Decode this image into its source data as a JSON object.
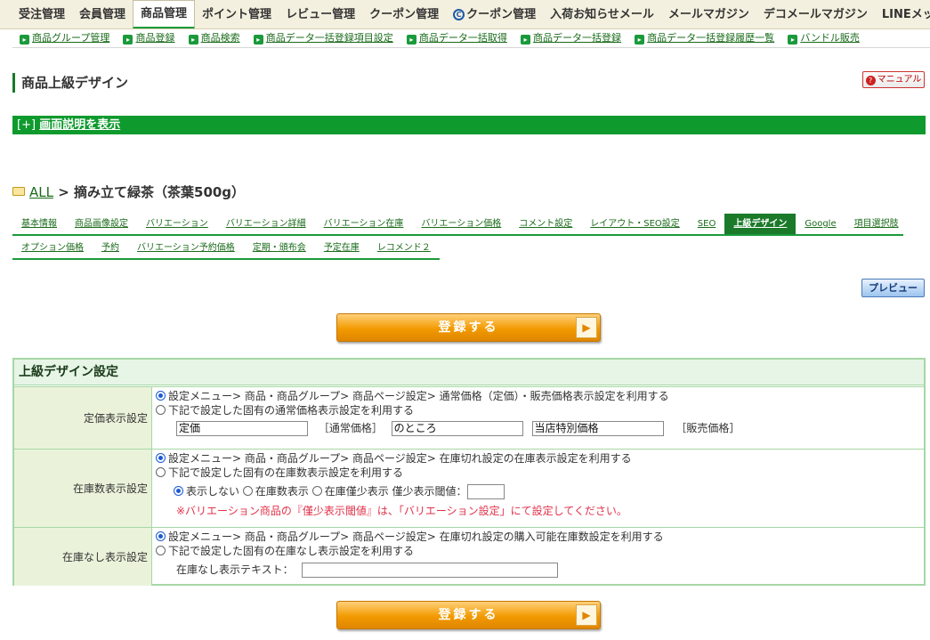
{
  "topnav": [
    "受注管理",
    "会員管理",
    "商品管理",
    "ポイント管理",
    "レビュー管理",
    "クーポン管理",
    "クーポン管理",
    "入荷お知らせメール",
    "メールマガジン",
    "デコメールマガジン",
    "LINEメッセー"
  ],
  "topnav_active_index": 2,
  "subnav": [
    "商品グループ管理",
    "商品登録",
    "商品検索",
    "商品データ一括登録項目設定",
    "商品データ一括取得",
    "商品データ一括登録",
    "商品データ一括登録履歴一覧",
    "バンドル販売"
  ],
  "page_title": "商品上級デザイン",
  "manual_label": "マニュアル",
  "help_toggle": "[+]",
  "help_link": "画面説明を表示",
  "breadcrumb": {
    "all": "ALL",
    "sep": " > ",
    "product": "摘み立て緑茶（茶葉500g）"
  },
  "tabs_row1": [
    "基本情報",
    "商品画像設定",
    "バリエーション",
    "バリエーション詳細",
    "バリエーション在庫",
    "バリエーション価格",
    "コメント設定",
    "レイアウト・SEO設定",
    "SEO",
    "上級デザイン",
    "Google",
    "項目選択肢"
  ],
  "tabs_row2": [
    "オプション価格",
    "予約",
    "バリエーション予約価格",
    "定期・頒布会",
    "予定在庫",
    "レコメンド２"
  ],
  "active_tab": "上級デザイン",
  "preview_label": "プレビュー",
  "save_label": "登録する",
  "settings": {
    "title": "上級デザイン設定",
    "price": {
      "label": "定価表示設定",
      "opt1": "設定メニュー> 商品・商品グループ> 商品ページ設定> 通常価格（定価）・販売価格表示設定を利用する",
      "opt2": "下記で設定した固有の通常価格表示設定を利用する",
      "field1": "定価",
      "tag1": "［通常価格］",
      "field2": "のところ",
      "field3": "当店特別価格",
      "tag2": "［販売価格］"
    },
    "stock": {
      "label": "在庫数表示設定",
      "opt1": "設定メニュー> 商品・商品グループ> 商品ページ設定> 在庫切れ設定の在庫表示設定を利用する",
      "opt2": "下記で設定した固有の在庫数表示設定を利用する",
      "sub_hide": "表示しない",
      "sub_show": "在庫数表示",
      "sub_few": "在庫僅少表示",
      "threshold_label": "僅少表示閾値：",
      "threshold_value": "",
      "note": "※バリエーション商品の『僅少表示閾値』は、「バリエーション設定」にて設定してください。"
    },
    "nostock": {
      "label": "在庫なし表示設定",
      "opt1": "設定メニュー> 商品・商品グループ> 商品ページ設定> 在庫切れ設定の購入可能在庫数設定を利用する",
      "opt2": "下記で設定した固有の在庫なし表示設定を利用する",
      "text_label": "在庫なし表示テキスト：",
      "text_value": ""
    }
  }
}
